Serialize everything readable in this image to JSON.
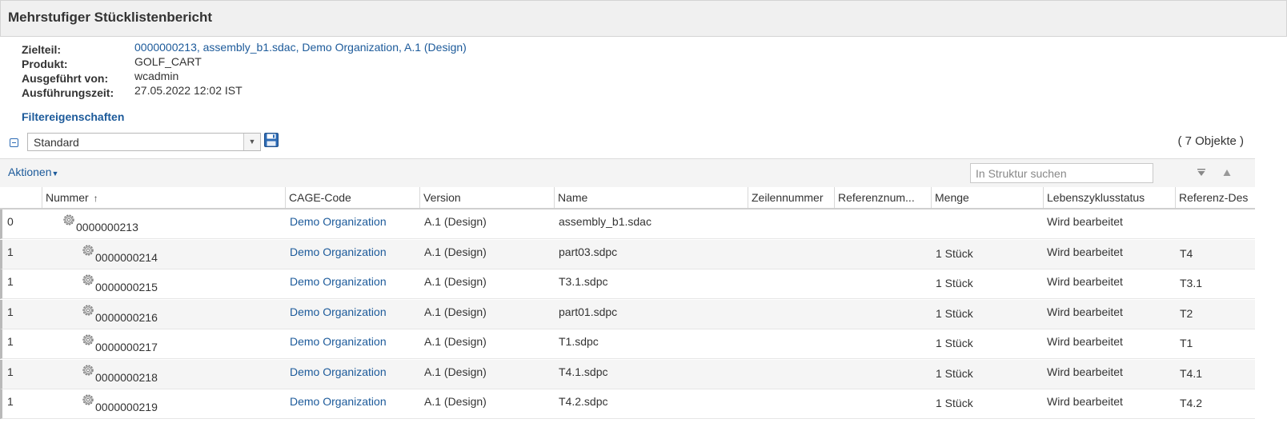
{
  "header": {
    "title": "Mehrstufiger Stücklistenbericht"
  },
  "info": {
    "rows": [
      {
        "label": "Zielteil:",
        "value": "0000000213, assembly_b1.sdac, Demo Organization, A.1 (Design)",
        "is_link": true
      },
      {
        "label": "Produkt:",
        "value": "GOLF_CART",
        "is_link": false
      },
      {
        "label": "Ausgeführt von:",
        "value": "wcadmin",
        "is_link": false
      },
      {
        "label": "Ausführungszeit:",
        "value": "27.05.2022 12:02 IST",
        "is_link": false
      }
    ],
    "filter_link": "Filtereigenschaften"
  },
  "view": {
    "selected": "Standard",
    "object_count": "( 7 Objekte )"
  },
  "toolbar": {
    "actions_label": "Aktionen",
    "search_placeholder": "In Struktur suchen"
  },
  "table": {
    "columns": [
      "",
      "Nummer",
      "CAGE-Code",
      "Version",
      "Name",
      "Zeilennummer",
      "Referenznum...",
      "Menge",
      "Lebenszyklusstatus",
      "Referenz-Des"
    ],
    "rows": [
      {
        "level": "0",
        "nummer": "0000000213",
        "cage": "Demo Organization",
        "version": "A.1 (Design)",
        "name": "assembly_b1.sdac",
        "menge": "",
        "status": "Wird bearbeitet",
        "refdes": ""
      },
      {
        "level": "1",
        "nummer": "0000000214",
        "cage": "Demo Organization",
        "version": "A.1 (Design)",
        "name": "part03.sdpc",
        "menge": "1 Stück",
        "status": "Wird bearbeitet",
        "refdes": "T4"
      },
      {
        "level": "1",
        "nummer": "0000000215",
        "cage": "Demo Organization",
        "version": "A.1 (Design)",
        "name": "T3.1.sdpc",
        "menge": "1 Stück",
        "status": "Wird bearbeitet",
        "refdes": "T3.1"
      },
      {
        "level": "1",
        "nummer": "0000000216",
        "cage": "Demo Organization",
        "version": "A.1 (Design)",
        "name": "part01.sdpc",
        "menge": "1 Stück",
        "status": "Wird bearbeitet",
        "refdes": "T2"
      },
      {
        "level": "1",
        "nummer": "0000000217",
        "cage": "Demo Organization",
        "version": "A.1 (Design)",
        "name": "T1.sdpc",
        "menge": "1 Stück",
        "status": "Wird bearbeitet",
        "refdes": "T1"
      },
      {
        "level": "1",
        "nummer": "0000000218",
        "cage": "Demo Organization",
        "version": "A.1 (Design)",
        "name": "T4.1.sdpc",
        "menge": "1 Stück",
        "status": "Wird bearbeitet",
        "refdes": "T4.1"
      },
      {
        "level": "1",
        "nummer": "0000000219",
        "cage": "Demo Organization",
        "version": "A.1 (Design)",
        "name": "T4.2.sdpc",
        "menge": "1 Stück",
        "status": "Wird bearbeitet",
        "refdes": "T4.2"
      }
    ]
  },
  "icons": {
    "part": "gear-icon",
    "save": "save-icon",
    "collapse": "collapse-icon",
    "filter": "filter-icon",
    "up": "arrow-up-icon",
    "sort": "sort-ascending-icon"
  },
  "colors": {
    "link": "#1c5a9a",
    "title_bar": "#f0f0f0",
    "row_alt": "#f5f5f5"
  }
}
